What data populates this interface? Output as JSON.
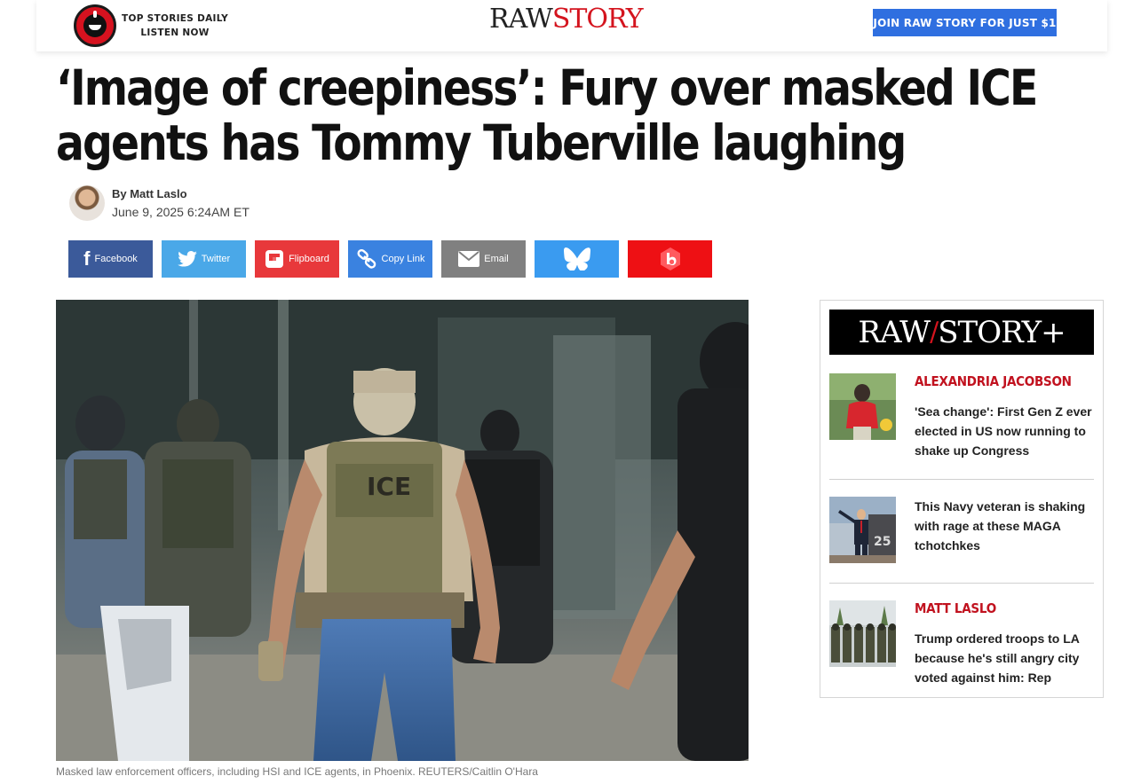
{
  "header": {
    "podcast_line1": "TOP STORIES DAILY",
    "podcast_line2": "LISTEN NOW",
    "logo_raw": "RAW",
    "logo_story": "STORY",
    "join_label": "JOIN RAW STORY FOR JUST $1"
  },
  "article": {
    "headline": "‘Image of creepiness’: Fury over masked ICE agents has Tommy Tuberville laughing",
    "byline": "By Matt Laslo",
    "date": "June 9, 2025 6:24AM ET",
    "caption": "Masked law enforcement officers, including HSI and ICE agents, in Phoenix. REUTERS/Caitlin O'Hara"
  },
  "share": {
    "facebook": "Facebook",
    "twitter": "Twitter",
    "flipboard": "Flipboard",
    "copy_link": "Copy Link",
    "email": "Email"
  },
  "sidebar": {
    "logo_raw": "RAW",
    "logo_story": "STORY+",
    "items": [
      {
        "author": "ALEXANDRIA JACOBSON",
        "title": "'Sea change': First Gen Z ever elected in US now running to shake up Congress"
      },
      {
        "author": "",
        "title": "This Navy veteran is shaking with rage at these MAGA tchotchkes"
      },
      {
        "author": "MATT LASLO",
        "title": "Trump ordered troops to LA because he's still angry city voted against him: Rep"
      }
    ]
  },
  "colors": {
    "brand_red": "#d4141e",
    "join_blue": "#2f6fe0",
    "facebook": "#3b5a9a",
    "twitter": "#4aa8e8",
    "flipboard": "#e8383b",
    "copy_link": "#3a82e0",
    "email": "#808080",
    "bluesky": "#3a9bf0",
    "beehiiv": "#ee1014"
  }
}
